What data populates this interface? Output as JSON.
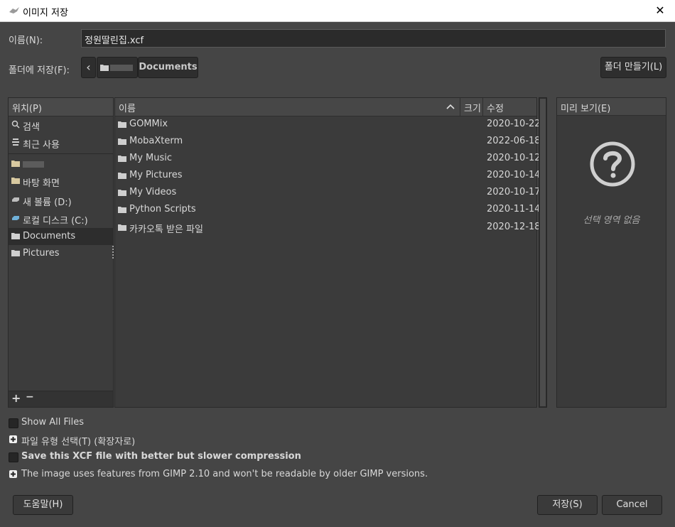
{
  "window": {
    "title": "이미지 저장",
    "close_glyph": "✕"
  },
  "name_row": {
    "label": "이름(N):",
    "value": "정원딸린집.xcf"
  },
  "folder_row": {
    "label": "폴더에 저장(F):",
    "back_glyph": "‹",
    "home_crumb_obscured": "",
    "current_crumb": "Documents",
    "new_folder_label": "폴더 만들기(L)"
  },
  "places": {
    "header": "위치(P)",
    "items": [
      {
        "label": "검색",
        "icon": "search-icon"
      },
      {
        "label": "최근 사용",
        "icon": "recent-icon"
      },
      {
        "label": "",
        "icon": "folder-icon"
      },
      {
        "label": "바탕 화면",
        "icon": "folder-icon"
      },
      {
        "label": "새 볼륨 (D:)",
        "icon": "drive-icon"
      },
      {
        "label": "로컬 디스크 (C:)",
        "icon": "drive-icon"
      },
      {
        "label": "Documents",
        "icon": "folder-icon",
        "selected": true
      },
      {
        "label": "Pictures",
        "icon": "folder-icon"
      }
    ],
    "add_glyph": "+",
    "remove_glyph": "−"
  },
  "files": {
    "columns": {
      "name": "이름",
      "size": "크기",
      "modified": "수정"
    },
    "sort_glyph": "^",
    "rows": [
      {
        "name": "GOMMix",
        "modified": "2020-10-22"
      },
      {
        "name": "MobaXterm",
        "modified": "2022-06-18"
      },
      {
        "name": "My Music",
        "modified": "2020-10-12"
      },
      {
        "name": "My Pictures",
        "modified": "2020-10-14"
      },
      {
        "name": "My Videos",
        "modified": "2020-10-17"
      },
      {
        "name": "Python Scripts",
        "modified": "2020-11-14"
      },
      {
        "name": "카카오톡 받은 파일",
        "modified": "2020-12-18"
      }
    ]
  },
  "preview": {
    "header": "미리 보기(E)",
    "empty_text": "선택 영역 없음"
  },
  "options": {
    "show_all_files": "Show All Files",
    "file_type": "파일 유형 선택(T) (확장자로)",
    "compression": "Save this XCF file with better but slower compression",
    "compat_note": "The image uses features from GIMP 2.10 and won't be readable by older GIMP versions."
  },
  "buttons": {
    "help": "도움말(H)",
    "save": "저장(S)",
    "cancel": "Cancel"
  },
  "colors": {
    "background": "#454545",
    "panel": "#3b3b3b",
    "text": "#d8d8d8"
  }
}
